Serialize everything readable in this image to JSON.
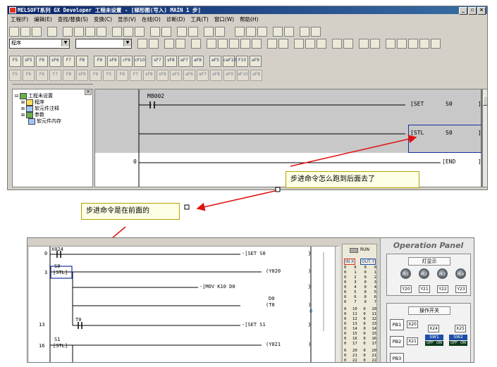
{
  "top_window": {
    "title": "MELSOFT系列 GX Developer 工程未设置 - [梯形图(写入)    MAIN    1 步]",
    "menu": [
      "工程(F)",
      "编辑(E)",
      "查找/替换(S)",
      "变换(C)",
      "显示(V)",
      "在线(O)",
      "诊断(D)",
      "工具(T)",
      "窗口(W)",
      "帮助(H)"
    ],
    "combo_program": "程序",
    "tree": {
      "root": "工程未设置",
      "items": [
        "程序",
        "软元件注释",
        "参数",
        "软元件内存"
      ]
    },
    "ladder": {
      "contact": "M8002",
      "inst1": "[SET",
      "op1": "S0",
      "inst2": "[STL",
      "op2": "S0",
      "step_end": "0",
      "inst3": "[END"
    }
  },
  "callouts": {
    "right": "步进命令怎么跑到后面去了",
    "left": "步进命令是在前面的"
  },
  "bottom_window": {
    "rungs": {
      "x024": "X024",
      "step0": "0",
      "set1": "-[SET   S0",
      "close1": "}",
      "s0": "S0",
      "step3": "3",
      "stl": "[STL]",
      "y020": "(Y020",
      "close2": ")",
      "mov": "-[MOV   K10    D0",
      "close3": "}",
      "d0": "D0",
      "t0out": "(T0",
      "close4": ")",
      "tval": "0",
      "t0": "T0",
      "step13": "13",
      "set2": "-[SET   S1",
      "close5": "}",
      "s1": "S1",
      "step16": "16",
      "stl2": "[STL]",
      "y021": "(Y021",
      "close6": ")"
    },
    "io": {
      "run": "RUN",
      "in_label": "IN X",
      "out_label": "OUT Y",
      "in_nums": [
        "0",
        "1",
        "2",
        "3",
        "4",
        "5",
        "6",
        "7",
        "10",
        "11",
        "12",
        "13",
        "14",
        "15",
        "16",
        "17",
        "20",
        "21",
        "22"
      ],
      "out_nums": [
        "0",
        "1",
        "2",
        "3",
        "4",
        "5",
        "6",
        "7",
        "10",
        "11",
        "12",
        "13",
        "14",
        "15",
        "16",
        "17",
        "20",
        "21",
        "22"
      ]
    },
    "panel": {
      "title": "Operation Panel",
      "lamp_section": "灯显示",
      "lamps": [
        "PL1",
        "PL2",
        "PL3",
        "PL4"
      ],
      "lamp_outputs": [
        "Y20",
        "Y21",
        "Y22",
        "Y23"
      ],
      "switch_section": "操作开关",
      "pb1": "PB1",
      "pb2": "PB2",
      "pb3": "PB3",
      "x20": "X20",
      "x21": "X21",
      "x24": "X24",
      "x25": "X25",
      "sw1": "SW1",
      "sw2": "SW2",
      "off": "OFF",
      "on": "ON"
    }
  },
  "colors": {
    "highlight_box": "#1c2f9c",
    "arrow": "#e01010",
    "gray_band": "#c8c8c8"
  }
}
